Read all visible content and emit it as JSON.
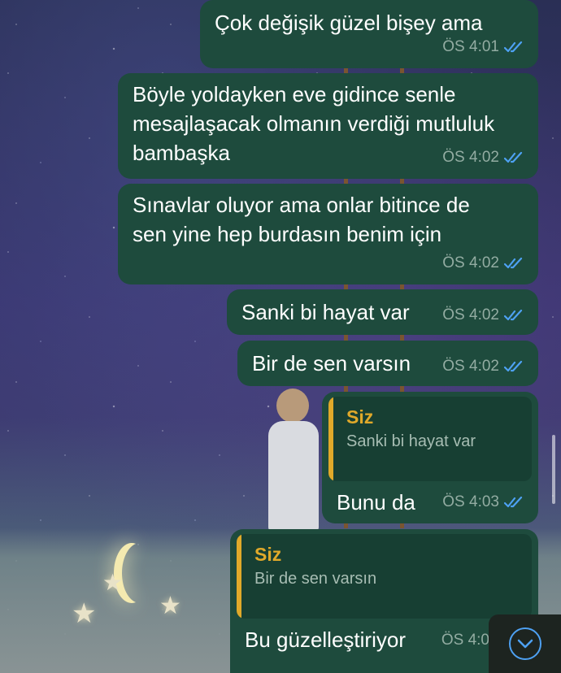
{
  "colors": {
    "bubble_bg": "#1e4b3d",
    "quote_bg": "#173f33",
    "quote_accent": "#e0a92a",
    "tick_blue": "#4ea1f3",
    "meta_text": "#93aca2"
  },
  "messages": [
    {
      "text": "Çok değişik güzel bişey ama",
      "time": "ÖS 4:01",
      "status_icon": "double-check-icon"
    },
    {
      "lines": [
        "Böyle yoldayken eve gidince senle",
        "mesajlaşacak olmanın verdiği mutluluk",
        "bambaşka"
      ],
      "time": "ÖS 4:02",
      "status_icon": "double-check-icon"
    },
    {
      "lines": [
        "Sınavlar oluyor ama onlar bitince de",
        "sen yine hep burdasın benim için"
      ],
      "time": "ÖS 4:02",
      "status_icon": "double-check-icon"
    },
    {
      "text": "Sanki bi hayat var",
      "time": "ÖS 4:02",
      "status_icon": "double-check-icon"
    },
    {
      "text": "Bir de sen varsın",
      "time": "ÖS 4:02",
      "status_icon": "double-check-icon"
    },
    {
      "reply": {
        "author": "Siz",
        "text": "Sanki bi hayat var"
      },
      "text": "Bunu da",
      "time": "ÖS 4:03",
      "status_icon": "double-check-icon"
    },
    {
      "reply": {
        "author": "Siz",
        "text": "Bir de sen varsın"
      },
      "text": "Bu güzelleştiriyor",
      "time": "ÖS 4:0",
      "status_icon": "double-check-icon"
    }
  ],
  "scroll_button_icon": "chevron-down-icon"
}
